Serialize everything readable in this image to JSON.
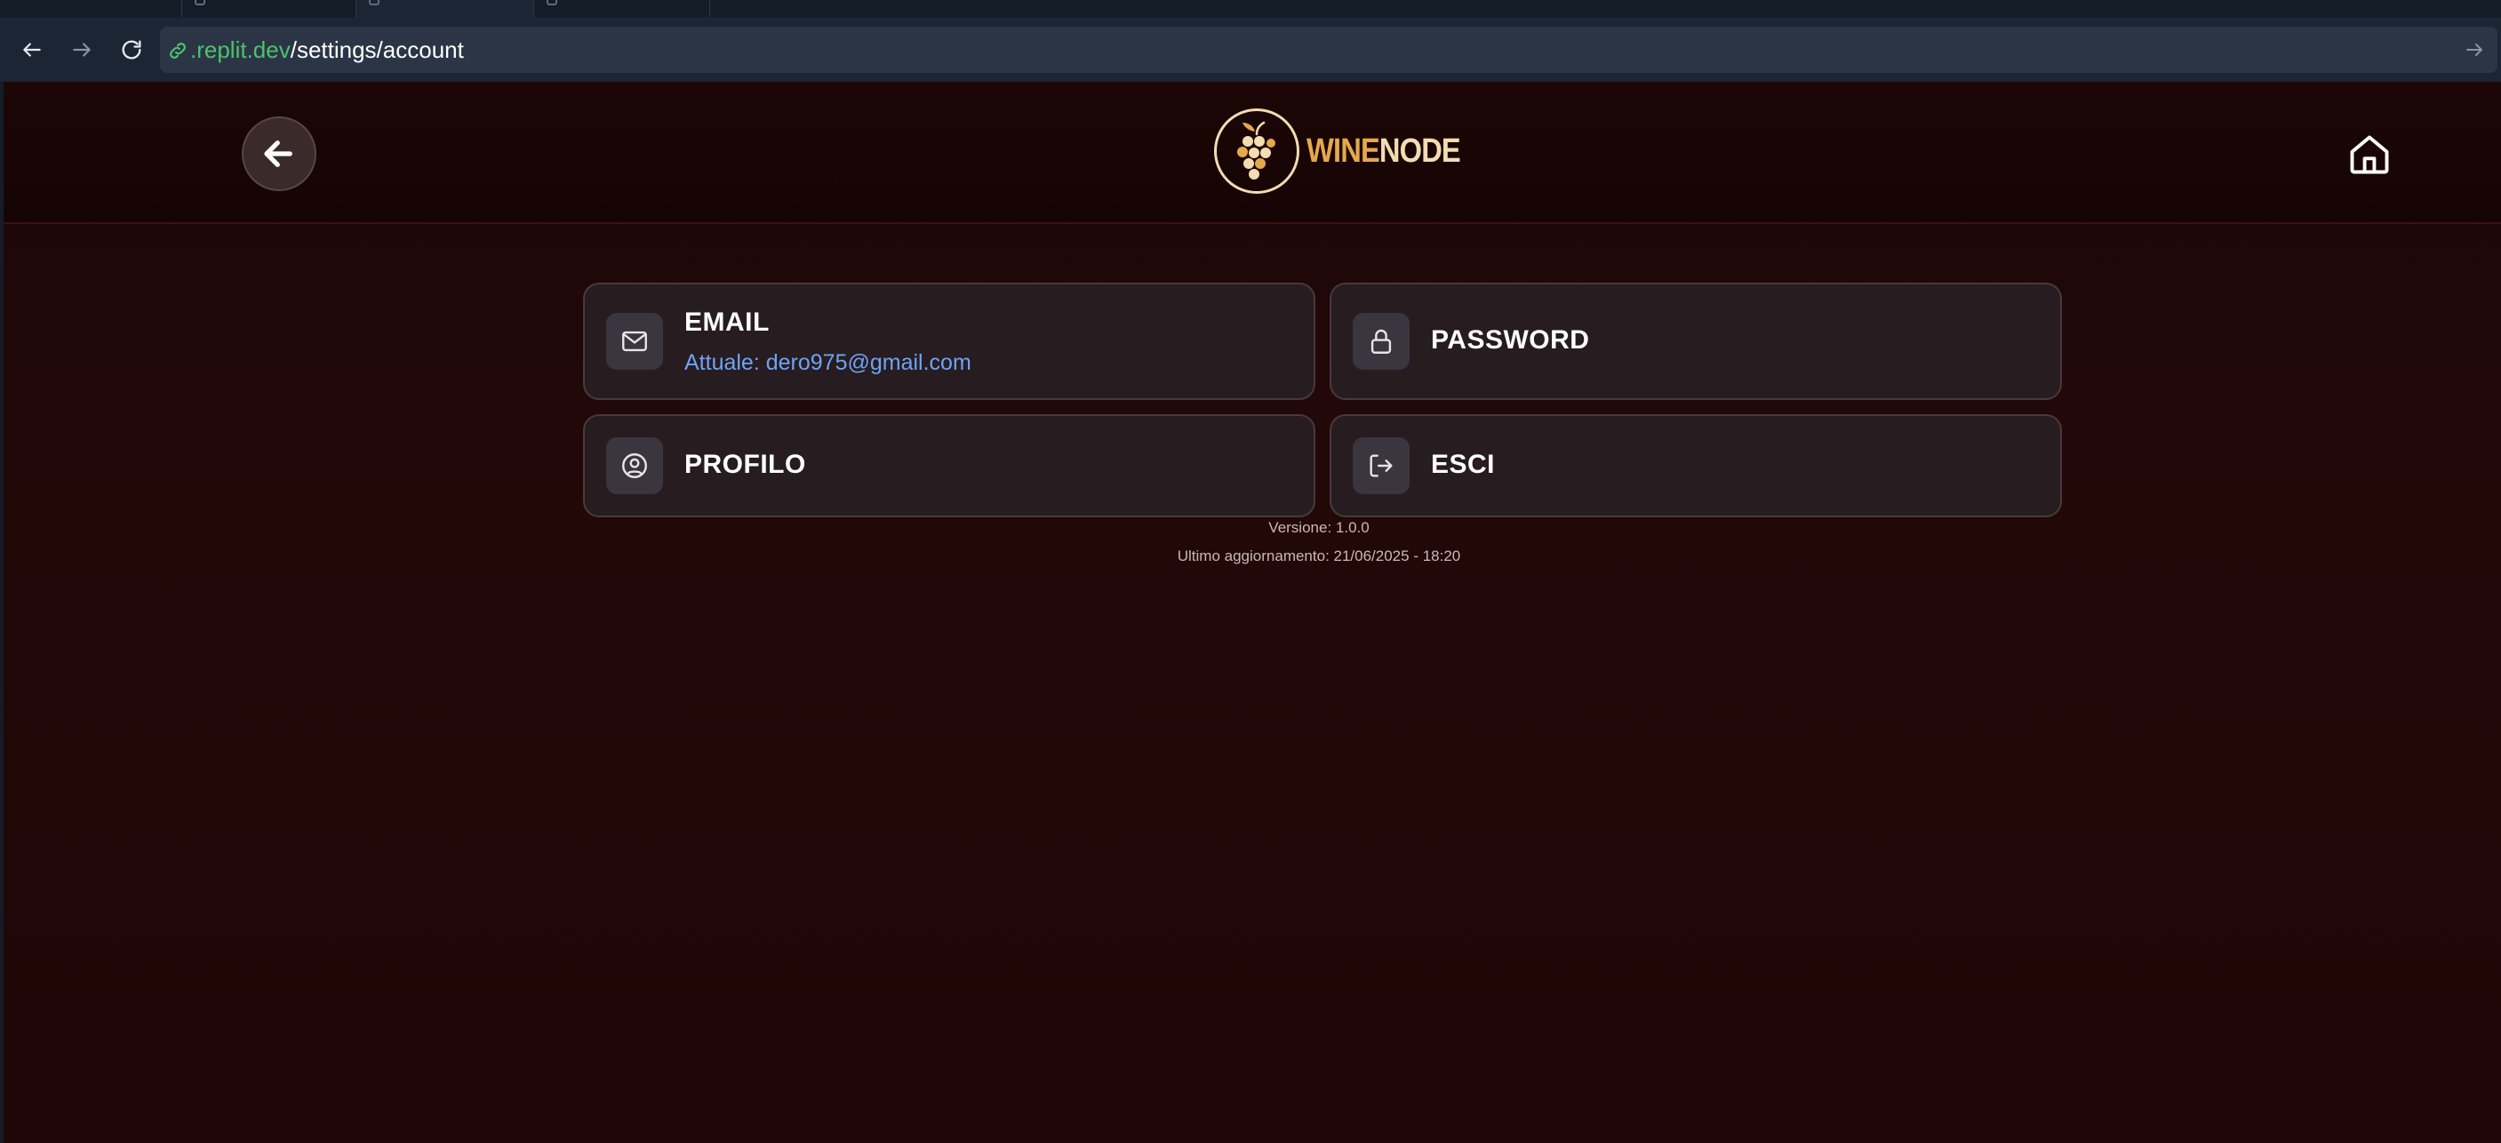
{
  "browser": {
    "url_domain": ".replit.dev",
    "url_path": "/settings/account"
  },
  "header": {
    "logo_wine": "WINE",
    "logo_node": "NODE"
  },
  "cards": {
    "email": {
      "title": "EMAIL",
      "subtitle": "Attuale: dero975@gmail.com"
    },
    "password": {
      "title": "PASSWORD"
    },
    "profile": {
      "title": "PROFILO"
    },
    "logout": {
      "title": "ESCI"
    }
  },
  "footer": {
    "version": "Versione: 1.0.0",
    "last_update": "Ultimo aggiornamento: 21/06/2025 - 18:20"
  },
  "colors": {
    "accent_blue": "#6ea3f5",
    "logo_gold": "#e5a84a",
    "logo_cream": "#f3dcb0",
    "url_domain_green": "#4cc26b"
  },
  "icons": {
    "back": "arrow-left-icon",
    "home": "home-icon",
    "email": "mail-icon",
    "password": "lock-icon",
    "profile": "user-circle-icon",
    "logout": "logout-icon",
    "logo": "grapes-icon"
  }
}
